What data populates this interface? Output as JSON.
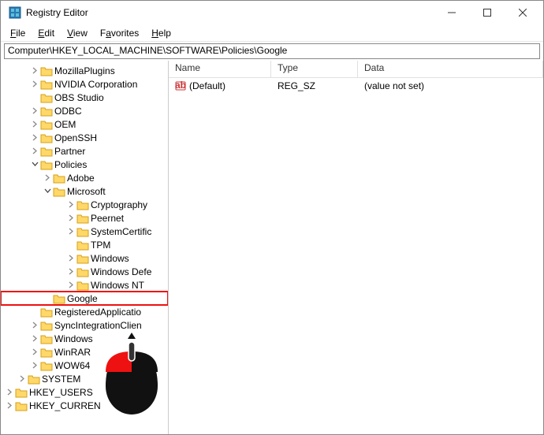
{
  "window": {
    "title": "Registry Editor"
  },
  "menu": {
    "file": "File",
    "edit": "Edit",
    "view": "View",
    "favorites": "Favorites",
    "help": "Help"
  },
  "address": "Computer\\HKEY_LOCAL_MACHINE\\SOFTWARE\\Policies\\Google",
  "columns": {
    "name": "Name",
    "type": "Type",
    "data": "Data"
  },
  "rows": [
    {
      "name": "(Default)",
      "type": "REG_SZ",
      "data": "(value not set)"
    }
  ],
  "tree": {
    "mozillaplugins": "MozillaPlugins",
    "nvidia": "NVIDIA Corporation",
    "obs": "OBS Studio",
    "odbc": "ODBC",
    "oem": "OEM",
    "openssh": "OpenSSH",
    "partner": "Partner",
    "policies": "Policies",
    "adobe": "Adobe",
    "microsoft": "Microsoft",
    "cryptography": "Cryptography",
    "peernet": "Peernet",
    "systemcert": "SystemCertific",
    "tpm": "TPM",
    "windows": "Windows",
    "windowsdefe": "Windows Defe",
    "windowsnt": "Windows NT",
    "google": "Google",
    "registeredapp": "RegisteredApplicatio",
    "syncintegration": "SyncIntegrationClien",
    "windows2": "Windows",
    "winrar": "WinRAR",
    "wow64": "WOW64",
    "system": "SYSTEM",
    "hkeyusers": "HKEY_USERS",
    "hkeycurrent": "HKEY_CURREN"
  }
}
